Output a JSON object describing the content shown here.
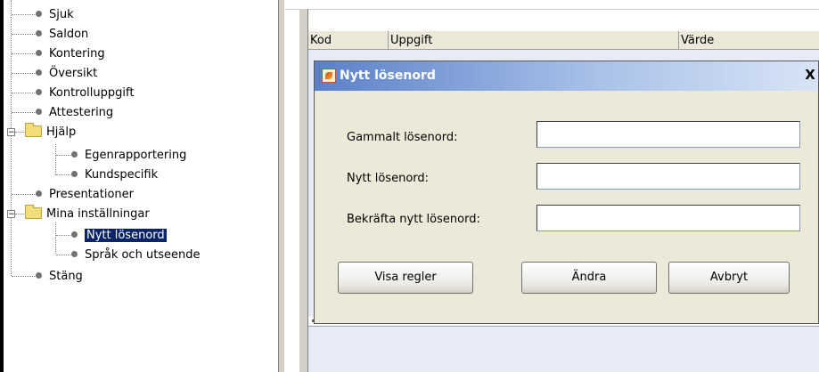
{
  "tree": {
    "items": [
      {
        "label": "Sjuk"
      },
      {
        "label": "Saldon"
      },
      {
        "label": "Kontering"
      },
      {
        "label": "Översikt"
      },
      {
        "label": "Kontrolluppgift"
      },
      {
        "label": "Attestering"
      },
      {
        "label": "Hjälp",
        "expanded": true,
        "children": [
          {
            "label": "Egenrapportering"
          },
          {
            "label": "Kundspecifik"
          }
        ]
      },
      {
        "label": "Presentationer"
      },
      {
        "label": "Mina inställningar",
        "expanded": true,
        "children": [
          {
            "label": "Nytt lösenord",
            "selected": true
          },
          {
            "label": "Språk och utseende"
          }
        ]
      },
      {
        "label": "Stäng"
      }
    ]
  },
  "table": {
    "columns": [
      "Kod",
      "Uppgift",
      "Värde"
    ]
  },
  "dialog": {
    "title": "Nytt lösenord",
    "close_glyph": "X",
    "fields": [
      {
        "label": "Gammalt lösenord:",
        "value": ""
      },
      {
        "label": "Nytt lösenord:",
        "value": ""
      },
      {
        "label": "Bekräfta nytt lösenord:",
        "value": ""
      }
    ],
    "buttons": {
      "show_rules": "Visa regler",
      "change": "Ändra",
      "cancel": "Avbryt"
    }
  },
  "colors": {
    "selection": "#0a246a",
    "titlebar_start": "#5a80c8",
    "dialog_bg": "#ece9d8"
  }
}
